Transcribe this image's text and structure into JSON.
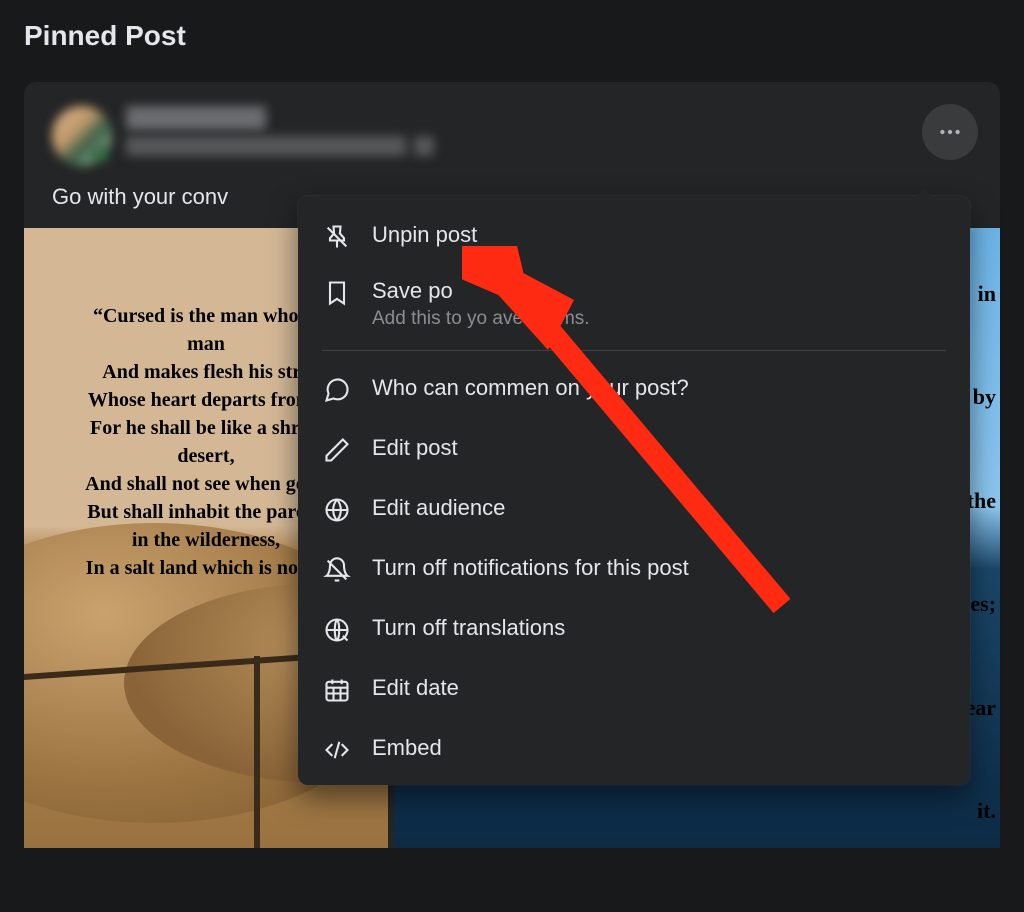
{
  "section_title": "Pinned Post",
  "post": {
    "text": "Go with your conv",
    "image_left_text": "“Cursed is the man who tr\nman\nAnd makes flesh his stre\nWhose heart departs from t\nFor he shall be like a shrub\ndesert,\nAnd shall not see when good\nBut shall inhabit the parche\nin the wilderness,\nIn a salt land which is not in",
    "image_right_text": "in\n\nd by\n\nthe\n\nies;\n\near\n\nit."
  },
  "menu": {
    "unpin": "Unpin post",
    "save": {
      "label": "Save po",
      "sub": "Add this to yo       aved items."
    },
    "who_comment": "Who can commen   on your post?",
    "edit_post": "Edit post",
    "edit_audience": "Edit audience",
    "turn_off_notifications": "Turn off notifications for this post",
    "turn_off_translations": "Turn off translations",
    "edit_date": "Edit date",
    "embed": "Embed"
  }
}
